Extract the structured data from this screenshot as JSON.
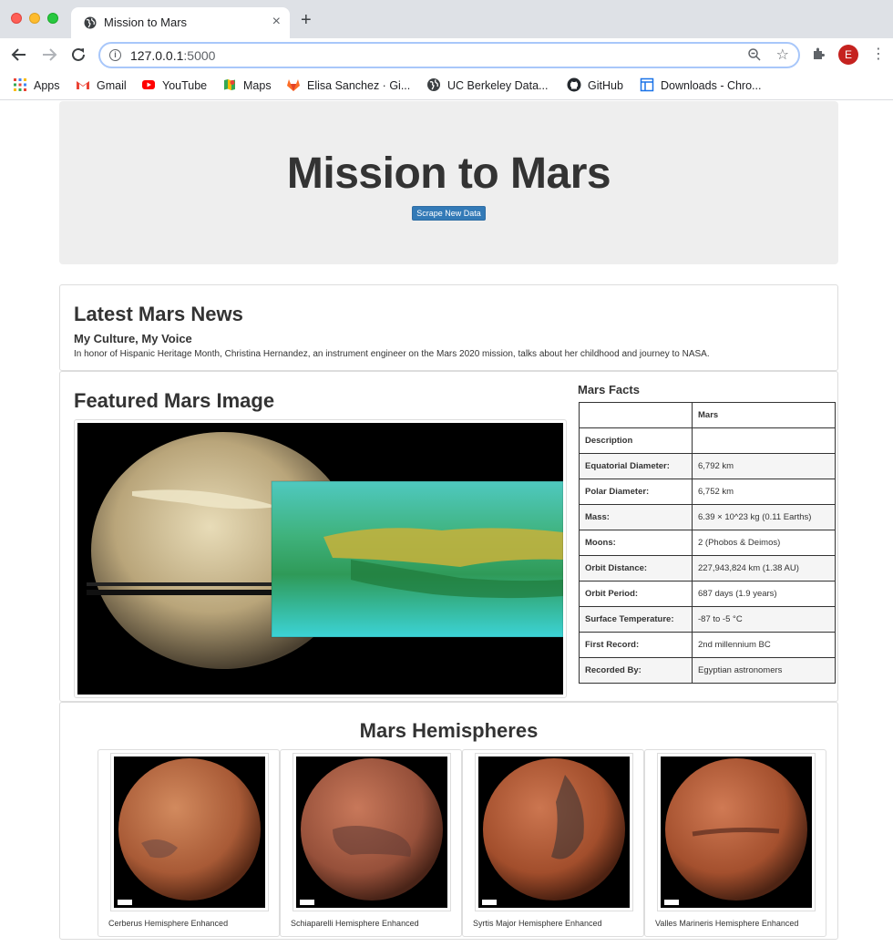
{
  "browser": {
    "tab_title": "Mission to Mars",
    "tab_close": "×",
    "new_tab": "+",
    "url_host": "127.0.0.1",
    "url_port": ":5000",
    "avatar_letter": "E",
    "bookmarks": [
      {
        "label": "Apps",
        "icon": "apps-grid-icon"
      },
      {
        "label": "Gmail",
        "icon": "gmail-icon"
      },
      {
        "label": "YouTube",
        "icon": "youtube-icon"
      },
      {
        "label": "Maps",
        "icon": "maps-icon"
      },
      {
        "label": "Elisa Sanchez · Gi...",
        "icon": "gitlab-icon"
      },
      {
        "label": "UC Berkeley Data...",
        "icon": "globe-icon"
      },
      {
        "label": "GitHub",
        "icon": "github-icon"
      },
      {
        "label": "Downloads - Chro...",
        "icon": "page-icon"
      }
    ]
  },
  "page": {
    "title": "Mission to Mars",
    "scrape_button": "Scrape New Data",
    "news": {
      "heading": "Latest Mars News",
      "title": "My Culture, My Voice",
      "paragraph": "In honor of Hispanic Heritage Month, Christina Hernandez, an instrument engineer on the Mars 2020 mission, talks about her childhood and journey to NASA."
    },
    "featured": {
      "heading": "Featured Mars Image"
    },
    "facts": {
      "heading": "Mars Facts",
      "header": [
        "",
        "Mars"
      ],
      "rows": [
        [
          "Description",
          ""
        ],
        [
          "Equatorial Diameter:",
          "6,792 km"
        ],
        [
          "Polar Diameter:",
          "6,752 km"
        ],
        [
          "Mass:",
          "6.39 × 10^23 kg (0.11 Earths)"
        ],
        [
          "Moons:",
          "2 (Phobos & Deimos)"
        ],
        [
          "Orbit Distance:",
          "227,943,824 km (1.38 AU)"
        ],
        [
          "Orbit Period:",
          "687 days (1.9 years)"
        ],
        [
          "Surface Temperature:",
          "-87 to -5 °C"
        ],
        [
          "First Record:",
          "2nd millennium BC"
        ],
        [
          "Recorded By:",
          "Egyptian astronomers"
        ]
      ]
    },
    "hemispheres": {
      "heading": "Mars Hemispheres",
      "items": [
        {
          "title": "Cerberus Hemisphere Enhanced"
        },
        {
          "title": "Schiaparelli Hemisphere Enhanced"
        },
        {
          "title": "Syrtis Major Hemisphere Enhanced"
        },
        {
          "title": "Valles Marineris Hemisphere Enhanced"
        }
      ]
    }
  }
}
